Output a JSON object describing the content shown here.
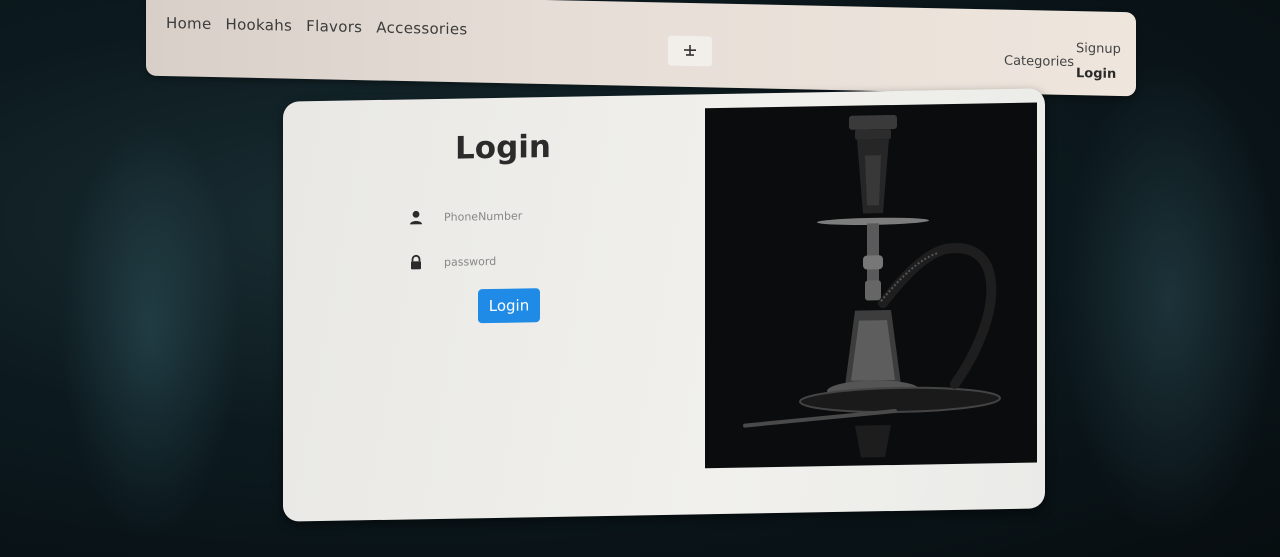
{
  "nav": {
    "links": [
      "Home",
      "Hookahs",
      "Flavors",
      "Accessories"
    ],
    "brand_icon": "hookah-logo-icon",
    "categories": "Categories",
    "signup": "Signup",
    "login": "Login"
  },
  "login": {
    "title": "Login",
    "phone_placeholder": "PhoneNumber",
    "password_placeholder": "password",
    "submit_label": "Login"
  },
  "colors": {
    "accent": "#1f8be6",
    "navbar_bg": "#e6ddd6",
    "card_bg": "#efeeea",
    "image_bg": "#0b0c0d"
  },
  "hero_image": {
    "icon": "hookah-image"
  }
}
